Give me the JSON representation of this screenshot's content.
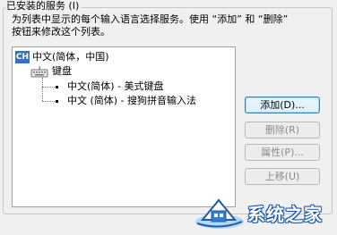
{
  "group": {
    "title": "已安装的服务 (I)"
  },
  "description": {
    "line1": "为列表中显示的每个输入语言选择服务。使用 “添加” 和 “删除”",
    "line2": "按钮来修改这个列表。"
  },
  "tree": {
    "language": {
      "badge": "CH",
      "label": "中文(简体，中国)"
    },
    "category": {
      "icon": "keyboard-icon",
      "label": "键盘"
    },
    "services": [
      {
        "label": "中文(简体) - 美式键盘"
      },
      {
        "label": "中文 (简体) - 搜狗拼音输入法"
      }
    ]
  },
  "buttons": {
    "add": "添加(D)...",
    "remove": "删除(R)",
    "properties": "属性(P)...",
    "move_up": "上移(U)"
  },
  "watermark": {
    "text": "系统之家"
  },
  "colors": {
    "badge": "#3a6fc4",
    "watermark_outline": "#1e5aa8",
    "disabled_text": "#8d8d8d"
  }
}
